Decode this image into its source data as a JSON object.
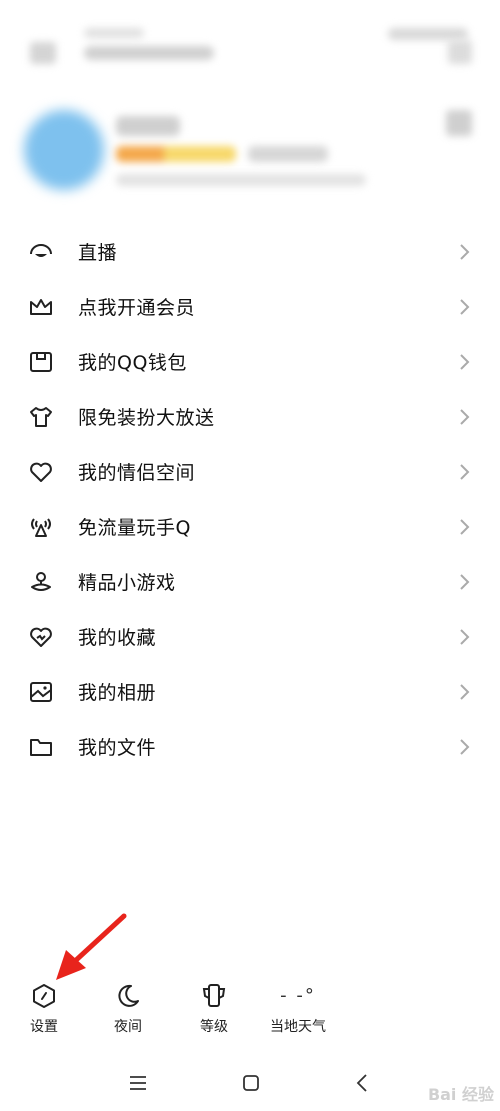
{
  "menu": {
    "items": [
      {
        "label": "直播",
        "icon": "live-icon"
      },
      {
        "label": "点我开通会员",
        "icon": "crown-icon"
      },
      {
        "label": "我的QQ钱包",
        "icon": "wallet-icon"
      },
      {
        "label": "限免装扮大放送",
        "icon": "tshirt-icon"
      },
      {
        "label": "我的情侣空间",
        "icon": "heart-icon"
      },
      {
        "label": "免流量玩手Q",
        "icon": "signal-tower-icon"
      },
      {
        "label": "精品小游戏",
        "icon": "game-pin-icon"
      },
      {
        "label": "我的收藏",
        "icon": "favorite-icon"
      },
      {
        "label": "我的相册",
        "icon": "album-icon"
      },
      {
        "label": "我的文件",
        "icon": "folder-icon"
      }
    ]
  },
  "toolbar": {
    "settings_label": "设置",
    "night_label": "夜间",
    "level_label": "等级",
    "weather_label": "当地天气",
    "weather_value": "- -°"
  },
  "system_nav": [
    "menu-icon",
    "home-icon",
    "back-icon"
  ],
  "watermark": "Bai 经验",
  "colors": {
    "annotation_arrow": "#e8241c",
    "avatar": "#7ec1ee"
  }
}
